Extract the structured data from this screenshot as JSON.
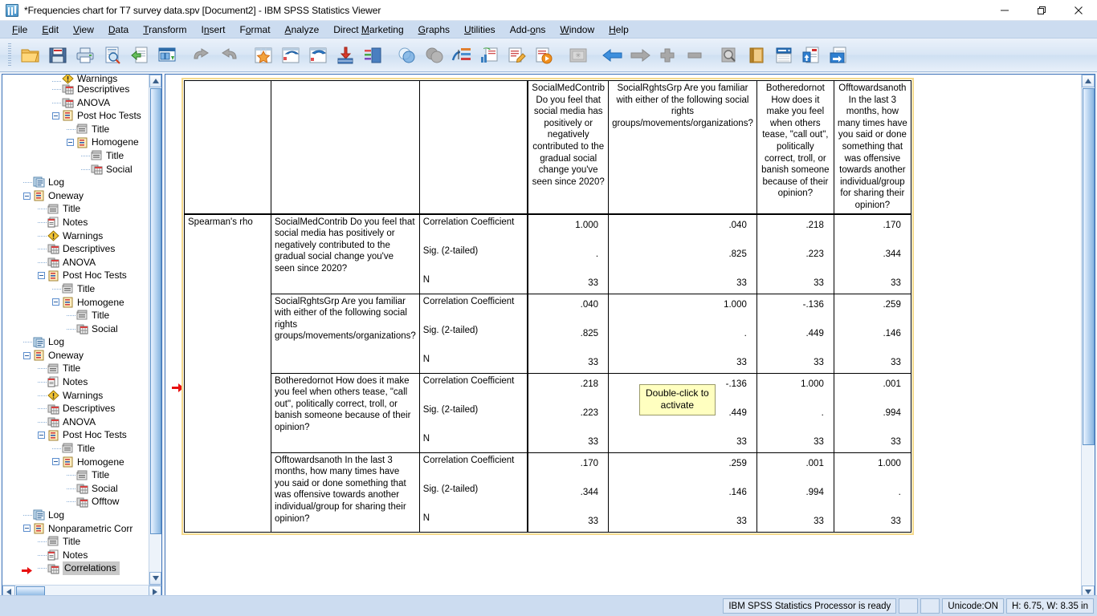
{
  "window": {
    "title": "*Frequencies chart for T7 survey data.spv [Document2] - IBM SPSS Statistics Viewer",
    "app_icon": "spss-logo-icon",
    "minimize_label": "—",
    "maximize_label": "❐",
    "close_label": "✕"
  },
  "menubar": {
    "items": [
      {
        "label": "File",
        "accel": "F"
      },
      {
        "label": "Edit",
        "accel": "E"
      },
      {
        "label": "View",
        "accel": "V"
      },
      {
        "label": "Data",
        "accel": "D"
      },
      {
        "label": "Transform",
        "accel": "T"
      },
      {
        "label": "Insert",
        "accel": "n"
      },
      {
        "label": "Format",
        "accel": "o"
      },
      {
        "label": "Analyze",
        "accel": "A"
      },
      {
        "label": "Direct Marketing",
        "accel": "M"
      },
      {
        "label": "Graphs",
        "accel": "G"
      },
      {
        "label": "Utilities",
        "accel": "U"
      },
      {
        "label": "Add-ons",
        "accel": "o"
      },
      {
        "label": "Window",
        "accel": "W"
      },
      {
        "label": "Help",
        "accel": "H"
      }
    ]
  },
  "toolbar": {
    "buttons": [
      {
        "name": "open-file-icon",
        "tip": "Open data document"
      },
      {
        "name": "save-icon",
        "tip": "Save this document"
      },
      {
        "name": "print-icon",
        "tip": "Print"
      },
      {
        "name": "print-preview-icon",
        "tip": "Print Preview"
      },
      {
        "name": "export-icon",
        "tip": "Export"
      },
      {
        "name": "dialog-recall-icon",
        "tip": "Recall recently used dialogs"
      },
      {
        "name": "undo-icon",
        "tip": "Undo"
      },
      {
        "name": "redo-icon",
        "tip": "Redo"
      },
      {
        "name": "goto-data-icon",
        "tip": "Go to data"
      },
      {
        "name": "goto-case-icon",
        "tip": "Go to case"
      },
      {
        "name": "goto-variable-icon",
        "tip": "Go to variable"
      },
      {
        "name": "insert-data-icon",
        "tip": "Insert data"
      },
      {
        "name": "variables-icon",
        "tip": "Variables"
      },
      {
        "name": "show-hide-icon",
        "tip": "Show / hide"
      },
      {
        "name": "select-all-icon",
        "tip": "Select all"
      },
      {
        "name": "create-chart-icon",
        "tip": "Create chart"
      },
      {
        "name": "insert-chart-icon",
        "tip": "Insert chart"
      },
      {
        "name": "edit-text-icon",
        "tip": "Insert text"
      },
      {
        "name": "run-script-icon",
        "tip": "Run script"
      },
      {
        "name": "placeholder-icon",
        "tip": "Insert object"
      },
      {
        "name": "promote-left-icon",
        "tip": "Promote"
      },
      {
        "name": "demote-right-icon",
        "tip": "Demote"
      },
      {
        "name": "expand-icon",
        "tip": "Expand"
      },
      {
        "name": "collapse-icon",
        "tip": "Collapse"
      },
      {
        "name": "find-icon",
        "tip": "Find"
      },
      {
        "name": "book-icon",
        "tip": "Variable book"
      },
      {
        "name": "list-icon",
        "tip": "Use sets"
      },
      {
        "name": "upload-doc-icon",
        "tip": "Upload document"
      },
      {
        "name": "export-doc-icon",
        "tip": "Export document"
      }
    ]
  },
  "outline": {
    "vertical_scroll_up": "▲",
    "vertical_scroll_down": "▼",
    "horizontal_scroll_left": "◄",
    "horizontal_scroll_right": "►",
    "items": [
      {
        "label": "Warnings",
        "indent": 3,
        "icon": "warnings-icon",
        "expander": false,
        "clipped": true
      },
      {
        "label": "Descriptives",
        "indent": 3,
        "icon": "table-icon",
        "expander": false
      },
      {
        "label": "ANOVA",
        "indent": 3,
        "icon": "table-icon",
        "expander": false
      },
      {
        "label": "Post Hoc Tests",
        "indent": 3,
        "icon": "output-icon",
        "expander": true
      },
      {
        "label": "Title",
        "indent": 4,
        "icon": "title-icon",
        "expander": false
      },
      {
        "label": "Homogene",
        "indent": 4,
        "icon": "output-icon",
        "expander": true
      },
      {
        "label": "Title",
        "indent": 5,
        "icon": "title-icon",
        "expander": false
      },
      {
        "label": "Social",
        "indent": 5,
        "icon": "table-icon",
        "expander": false
      },
      {
        "label": "Log",
        "indent": 1,
        "icon": "log-icon",
        "expander": false
      },
      {
        "label": "Oneway",
        "indent": 1,
        "icon": "output-icon",
        "expander": true
      },
      {
        "label": "Title",
        "indent": 2,
        "icon": "title-icon",
        "expander": false
      },
      {
        "label": "Notes",
        "indent": 2,
        "icon": "notes-icon",
        "expander": false
      },
      {
        "label": "Warnings",
        "indent": 2,
        "icon": "warnings-icon",
        "expander": false
      },
      {
        "label": "Descriptives",
        "indent": 2,
        "icon": "table-icon",
        "expander": false
      },
      {
        "label": "ANOVA",
        "indent": 2,
        "icon": "table-icon",
        "expander": false
      },
      {
        "label": "Post Hoc Tests",
        "indent": 2,
        "icon": "output-icon",
        "expander": true
      },
      {
        "label": "Title",
        "indent": 3,
        "icon": "title-icon",
        "expander": false
      },
      {
        "label": "Homogene",
        "indent": 3,
        "icon": "output-icon",
        "expander": true
      },
      {
        "label": "Title",
        "indent": 4,
        "icon": "title-icon",
        "expander": false
      },
      {
        "label": "Social",
        "indent": 4,
        "icon": "table-icon",
        "expander": false
      },
      {
        "label": "Log",
        "indent": 1,
        "icon": "log-icon",
        "expander": false
      },
      {
        "label": "Oneway",
        "indent": 1,
        "icon": "output-icon",
        "expander": true
      },
      {
        "label": "Title",
        "indent": 2,
        "icon": "title-icon",
        "expander": false
      },
      {
        "label": "Notes",
        "indent": 2,
        "icon": "notes-icon",
        "expander": false
      },
      {
        "label": "Warnings",
        "indent": 2,
        "icon": "warnings-icon",
        "expander": false
      },
      {
        "label": "Descriptives",
        "indent": 2,
        "icon": "table-icon",
        "expander": false
      },
      {
        "label": "ANOVA",
        "indent": 2,
        "icon": "table-icon",
        "expander": false
      },
      {
        "label": "Post Hoc Tests",
        "indent": 2,
        "icon": "output-icon",
        "expander": true
      },
      {
        "label": "Title",
        "indent": 3,
        "icon": "title-icon",
        "expander": false
      },
      {
        "label": "Homogene",
        "indent": 3,
        "icon": "output-icon",
        "expander": true
      },
      {
        "label": "Title",
        "indent": 4,
        "icon": "title-icon",
        "expander": false
      },
      {
        "label": "Social",
        "indent": 4,
        "icon": "table-icon",
        "expander": false
      },
      {
        "label": "Offtow",
        "indent": 4,
        "icon": "table-icon",
        "expander": false
      },
      {
        "label": "Log",
        "indent": 1,
        "icon": "log-icon",
        "expander": false
      },
      {
        "label": "Nonparametric Corr",
        "indent": 1,
        "icon": "output-icon",
        "expander": true
      },
      {
        "label": "Title",
        "indent": 2,
        "icon": "title-icon",
        "expander": false
      },
      {
        "label": "Notes",
        "indent": 2,
        "icon": "notes-icon",
        "expander": false
      },
      {
        "label": "Correlations",
        "indent": 2,
        "icon": "table-icon",
        "expander": false,
        "selected": true,
        "marker": true
      }
    ]
  },
  "document": {
    "selection_marker": "red-arrow-marker",
    "tooltip": {
      "line1": "Double-click to",
      "line2": "activate"
    },
    "table": {
      "corner_label": "",
      "column_headers": [
        "SocialMedContrib Do you feel that social media has positively or negatively contributed to the gradual social change you've seen since 2020?",
        "SocialRghtsGrp Are you familiar with either of the following social rights groups/movements/organizations?",
        "Botheredornot How does it make you feel when others tease, \"call out\", politically correct, troll, or banish someone because of their opinion?",
        "Offtowardsanoth In the last 3 months, how many times have you said or done something that was offensive towards another individual/group for sharing their opinion?"
      ],
      "method_label": "Spearman's rho",
      "stat_labels": [
        "Correlation Coefficient",
        "Sig. (2-tailed)",
        "N"
      ],
      "rows": [
        {
          "label": "SocialMedContrib Do you feel that social media has positively or negatively contributed to the gradual social change you've seen since 2020?",
          "correlation": [
            "1.000",
            ".040",
            ".218",
            ".170"
          ],
          "sig": [
            ".",
            ".825",
            ".223",
            ".344"
          ],
          "n": [
            "33",
            "33",
            "33",
            "33"
          ]
        },
        {
          "label": "SocialRghtsGrp Are you familiar with either of the following social rights groups/movements/organizations?",
          "correlation": [
            ".040",
            "1.000",
            "-.136",
            ".259"
          ],
          "sig": [
            ".825",
            ".",
            ".449",
            ".146"
          ],
          "n": [
            "33",
            "33",
            "33",
            "33"
          ]
        },
        {
          "label": "Botheredornot How does it make you feel when others tease, \"call out\", politically correct, troll, or banish someone because of their opinion?",
          "correlation": [
            ".218",
            "-.136",
            "1.000",
            ".001"
          ],
          "sig": [
            ".223",
            ".449",
            ".",
            ".994"
          ],
          "n": [
            "33",
            "33",
            "33",
            "33"
          ]
        },
        {
          "label": "Offtowardsanoth In the last 3 months, how many times have you said or done something that was offensive towards another individual/group for sharing their opinion?",
          "correlation": [
            ".170",
            ".259",
            ".001",
            "1.000"
          ],
          "sig": [
            ".344",
            ".146",
            ".994",
            "."
          ],
          "n": [
            "33",
            "33",
            "33",
            "33"
          ]
        }
      ]
    }
  },
  "statusbar": {
    "processor": "IBM SPSS Statistics Processor is ready",
    "spacer1": "",
    "spacer2": "",
    "unicode": "Unicode:ON",
    "dimensions": "H: 6.75, W: 8.35 in"
  },
  "colors": {
    "menu_bg": "#ccdcf0",
    "selection_border": "#f5d98b",
    "tooltip_bg": "#ffffc0",
    "marker_red": "#e81010",
    "pane_border": "#3f73b8"
  }
}
